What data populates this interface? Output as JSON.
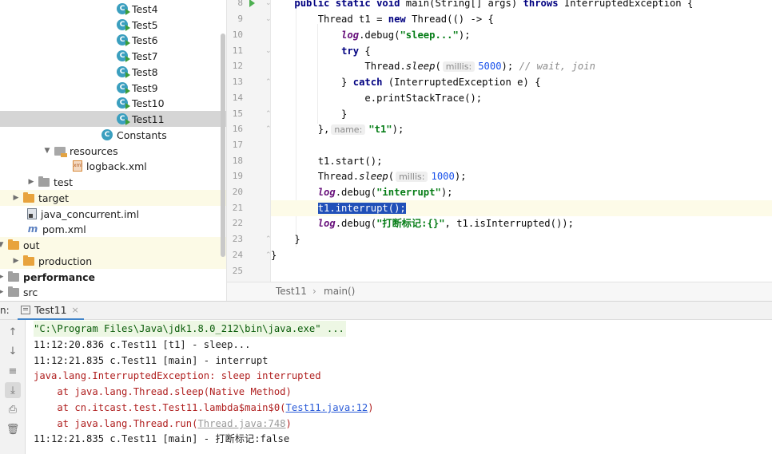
{
  "tree": {
    "items": [
      {
        "label": "Test4",
        "icon": "class-icon",
        "run": true
      },
      {
        "label": "Test5",
        "icon": "class-icon",
        "run": true
      },
      {
        "label": "Test6",
        "icon": "class-icon",
        "run": true
      },
      {
        "label": "Test7",
        "icon": "class-icon",
        "run": true
      },
      {
        "label": "Test8",
        "icon": "class-icon",
        "run": true
      },
      {
        "label": "Test9",
        "icon": "class-icon",
        "run": true
      },
      {
        "label": "Test10",
        "icon": "class-icon",
        "run": true
      },
      {
        "label": "Test11",
        "icon": "class-icon",
        "run": true,
        "selected": true
      },
      {
        "label": "Constants",
        "icon": "class-icon"
      },
      {
        "label": "resources",
        "icon": "resources-folder-icon",
        "expanded": true
      },
      {
        "label": "logback.xml",
        "icon": "xml-file-icon"
      },
      {
        "label": "test",
        "icon": "folder-icon",
        "collapsed": true
      },
      {
        "label": "target",
        "icon": "folder-icon",
        "collapsed": true
      },
      {
        "label": "java_concurrent.iml",
        "icon": "iml-file-icon"
      },
      {
        "label": "pom.xml",
        "icon": "maven-icon"
      },
      {
        "label": "out",
        "icon": "folder-icon",
        "expanded": true
      },
      {
        "label": "production",
        "icon": "folder-icon",
        "collapsed": true
      },
      {
        "label": "performance",
        "icon": "folder-icon",
        "collapsed": true
      },
      {
        "label": "src",
        "icon": "folder-icon",
        "collapsed": true
      }
    ]
  },
  "editor": {
    "line_numbers": [
      "8",
      "9",
      "10",
      "11",
      "12",
      "13",
      "14",
      "15",
      "16",
      "17",
      "18",
      "19",
      "20",
      "21",
      "22",
      "23",
      "24",
      "25"
    ],
    "current_line": "21",
    "hints": {
      "millis": "millis:",
      "name": "name:"
    }
  },
  "breadcrumb": {
    "class_name": "Test11",
    "method_name": "main()"
  },
  "run_panel": {
    "label": "n:",
    "tab_label": "Test11",
    "close_glyph": "×",
    "console": {
      "command": "\"C:\\Program Files\\Java\\jdk1.8.0_212\\bin\\java.exe\" ...",
      "log_sleep": "11:12:20.836 c.Test11 [t1] - sleep...",
      "log_interrupt": "11:12:21.835 c.Test11 [main] - interrupt",
      "exception": "java.lang.InterruptedException: sleep interrupted",
      "trace1": "    at java.lang.Thread.sleep(Native Method)",
      "trace2_prefix": "    at cn.itcast.test.Test11.lambda$main$0(",
      "trace2_link": "Test11.java:12",
      "trace2_suffix": ")",
      "trace3_prefix": "    at java.lang.Thread.run(",
      "trace3_link": "Thread.java:748",
      "trace3_suffix": ")",
      "log_flag": "11:12:21.835 c.Test11 [main] - 打断标记:false"
    }
  },
  "colors": {
    "accent": "#4083c9",
    "selection": "#2150b8",
    "keyword": "#000080",
    "string": "#067d17",
    "error": "#b02020"
  }
}
